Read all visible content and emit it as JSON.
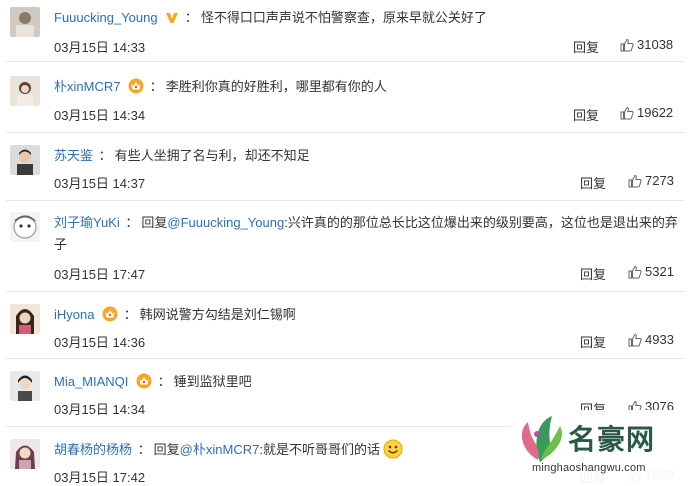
{
  "comments": [
    {
      "username": "Fuuucking_Young",
      "badge": "v-verified-icon",
      "separator": "：",
      "text": "怪不得口口声声说不怕警察查，原来早就公关好了",
      "date": "03月15日 14:33",
      "reply_label": "回复",
      "likes": "31038"
    },
    {
      "username": "朴xinMCR7",
      "badge": "crown-member-icon",
      "separator": "：",
      "text": "李胜利你真的好胜利，哪里都有你的人",
      "date": "03月15日 14:34",
      "reply_label": "回复",
      "likes": "19622"
    },
    {
      "username": "苏天鉴",
      "badge": "",
      "separator": "：",
      "text": "有些人坐拥了名与利，却还不知足",
      "date": "03月15日 14:37",
      "reply_label": "回复",
      "likes": "7273"
    },
    {
      "username": "刘子瑜YuKi",
      "badge": "",
      "separator": "：",
      "reply_prefix": "回复",
      "mention": "@Fuuucking_Young",
      "text": ":兴许真的的那位总长比这位爆出来的级别要高，这位也是退出来的弃子",
      "date": "03月15日 17:47",
      "reply_label": "回复",
      "likes": "5321"
    },
    {
      "username": "iHyona",
      "badge": "crown-member-icon",
      "separator": "：",
      "text": "韩网说警方勾结是刘仁锡啊",
      "date": "03月15日 14:36",
      "reply_label": "回复",
      "likes": "4933"
    },
    {
      "username": "Mia_MIANQI",
      "badge": "crown-member-icon",
      "separator": "：",
      "text": "锤到监狱里吧",
      "date": "03月15日 14:34",
      "reply_label": "回复",
      "likes": "3076"
    },
    {
      "username": "胡春杨的杨杨",
      "badge": "",
      "separator": "：",
      "reply_prefix": "回复",
      "mention": "@朴xinMCR7",
      "text": ":就是不听哥哥们的话",
      "emoji": "smile-emoji-icon",
      "date": "03月15日 17:42",
      "reply_label": "回复",
      "likes": "1969"
    }
  ],
  "watermark": {
    "title": "名豪网",
    "url": "minghaoshangwu.com"
  },
  "colors": {
    "username": "#2d70b3",
    "text": "#333333",
    "divider": "#e6e6e6",
    "vip_badge": "#f5a623",
    "verified": "#f5a623"
  }
}
